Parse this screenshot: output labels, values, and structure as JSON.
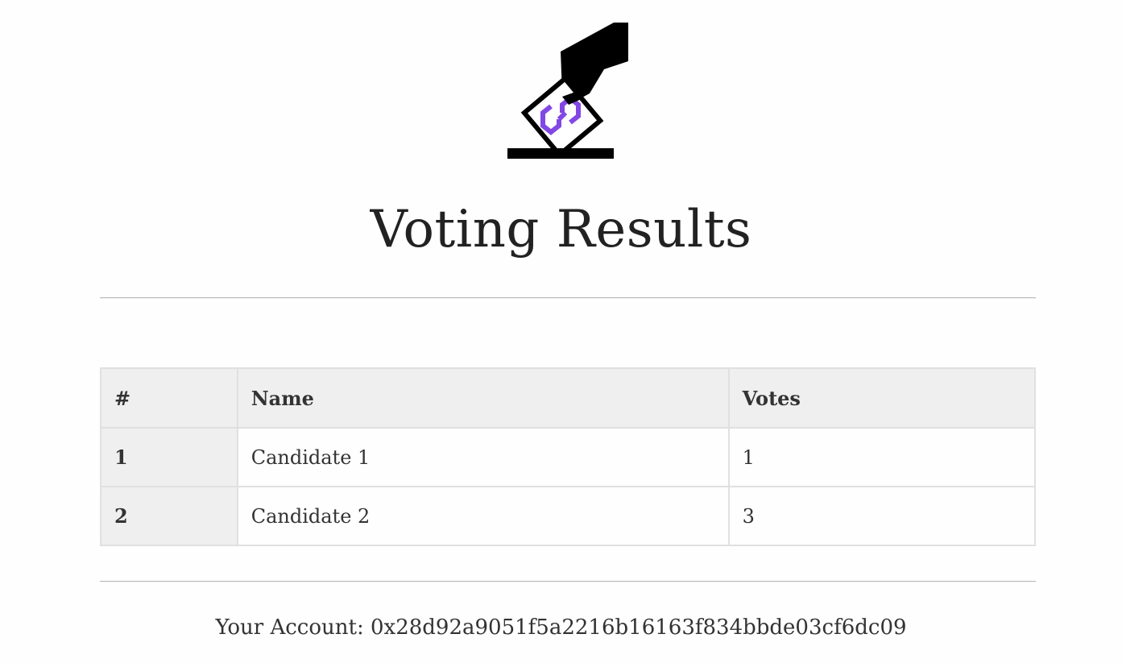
{
  "page": {
    "title": "Voting Results",
    "logo_icon": "ballot-box-hand-icon",
    "accent_color": "#8247e5"
  },
  "table": {
    "headers": {
      "index": "#",
      "name": "Name",
      "votes": "Votes"
    },
    "rows": [
      {
        "index": "1",
        "name": "Candidate 1",
        "votes": "1"
      },
      {
        "index": "2",
        "name": "Candidate 2",
        "votes": "3"
      }
    ]
  },
  "account": {
    "label": "Your Account: ",
    "address": "0x28d92a9051f5a2216b16163f834bbde03cf6dc09"
  }
}
